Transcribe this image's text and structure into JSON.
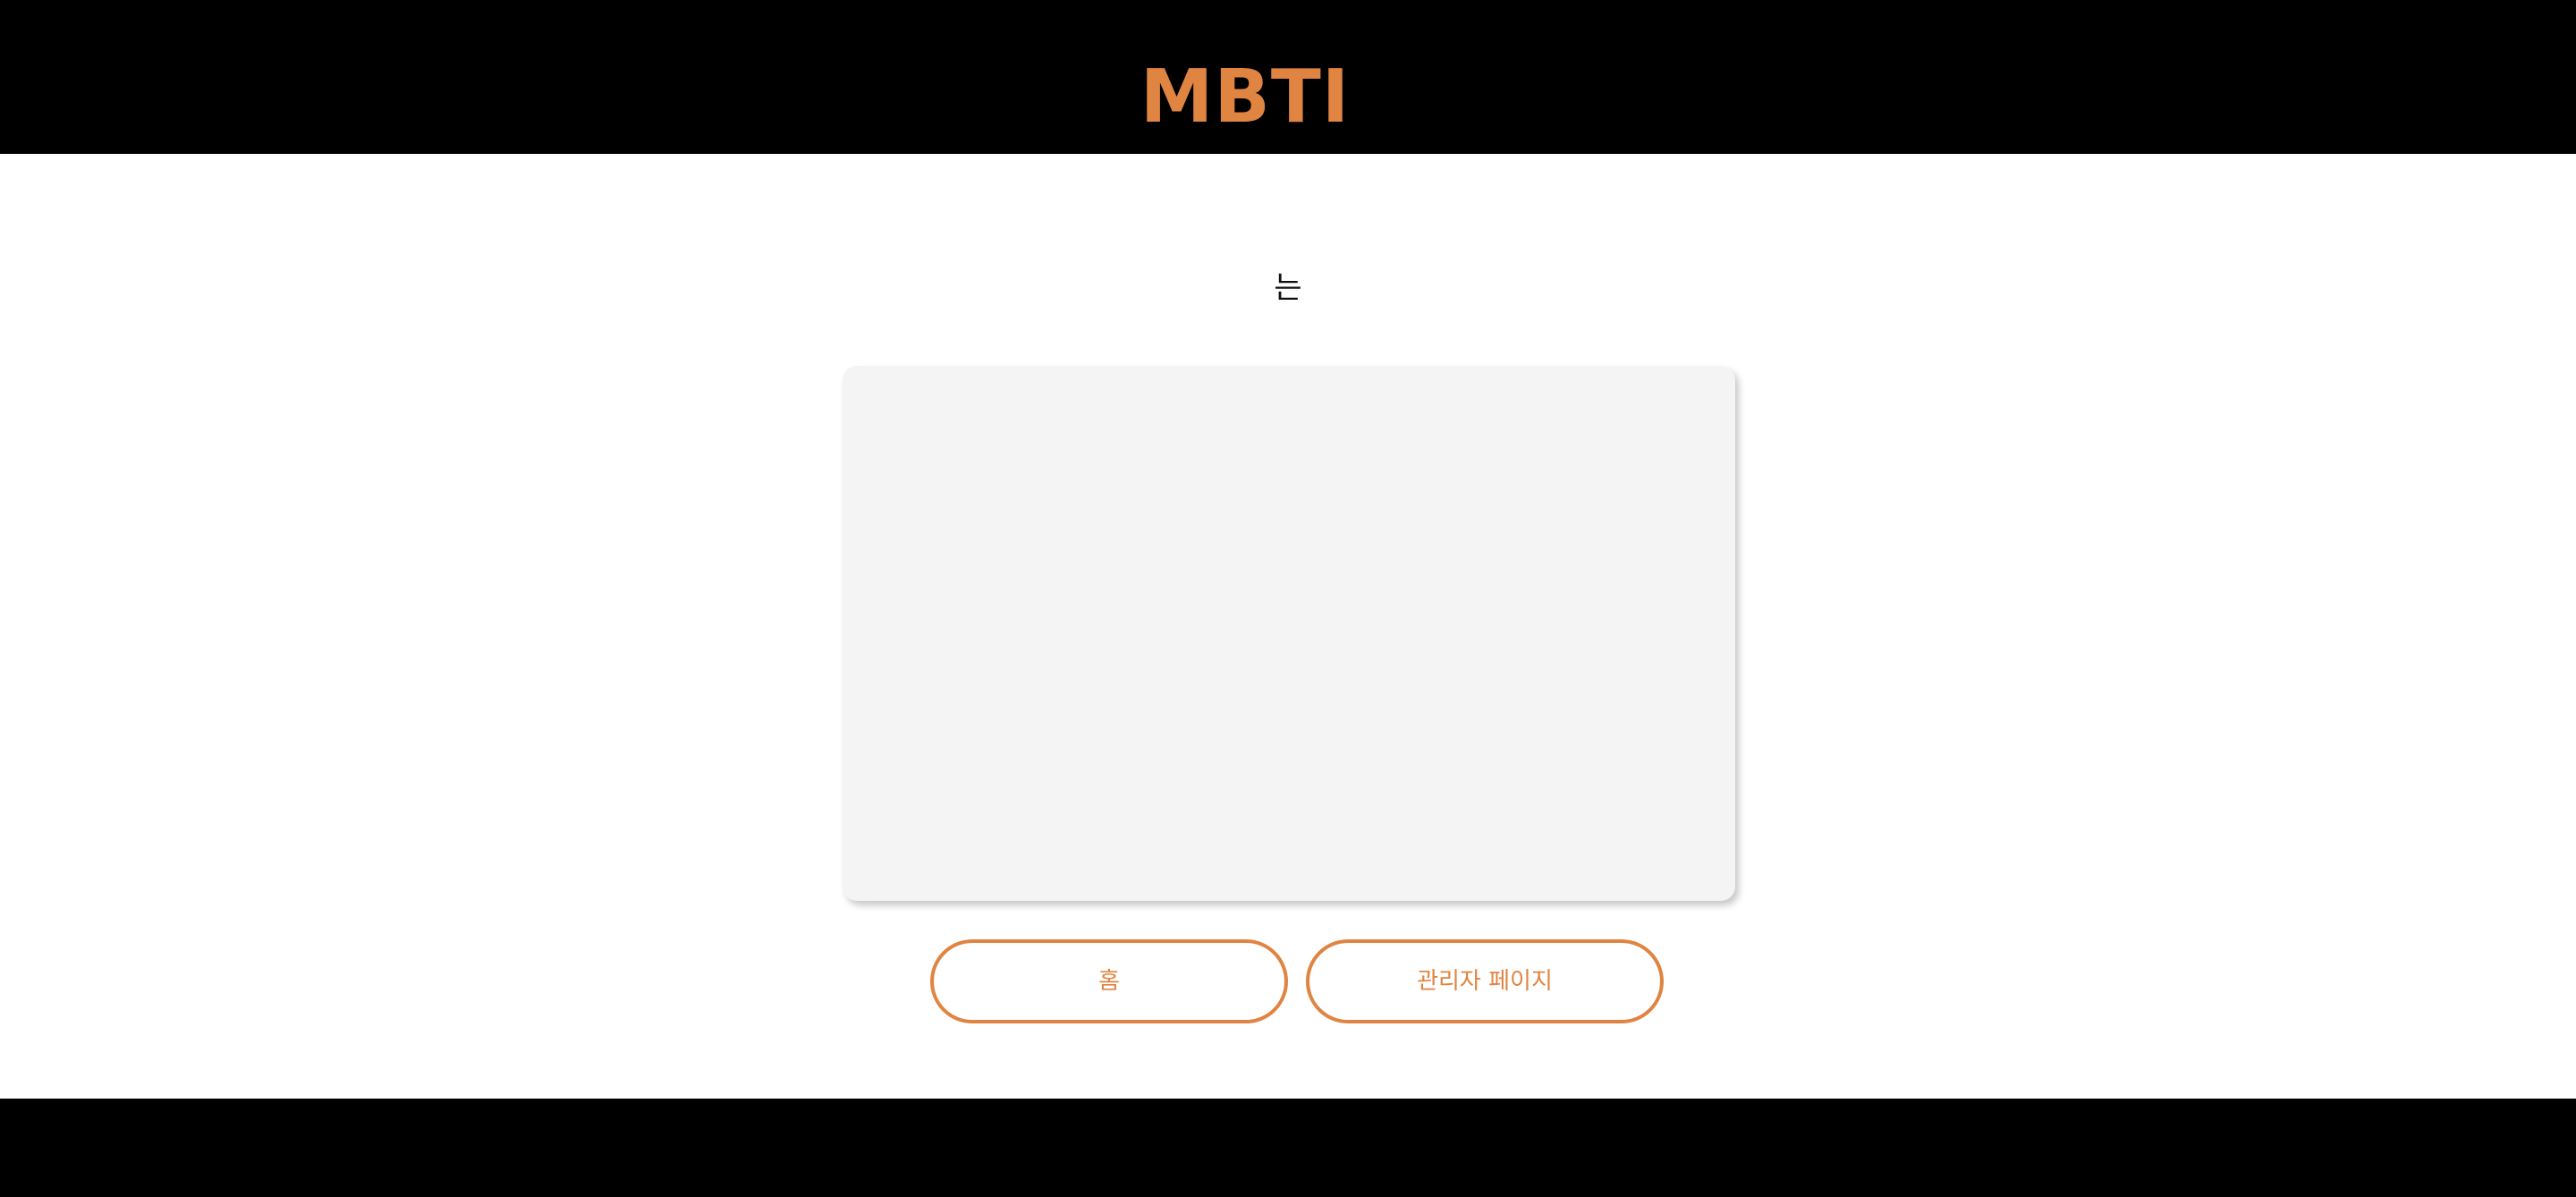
{
  "header": {
    "logo_text": "MBTI"
  },
  "main": {
    "question_text": "는",
    "buttons": {
      "home_label": "홈",
      "admin_label": "관리자 페이지"
    }
  },
  "colors": {
    "accent": "#e08442",
    "header_bg": "#000000",
    "card_bg": "#f4f4f4"
  }
}
